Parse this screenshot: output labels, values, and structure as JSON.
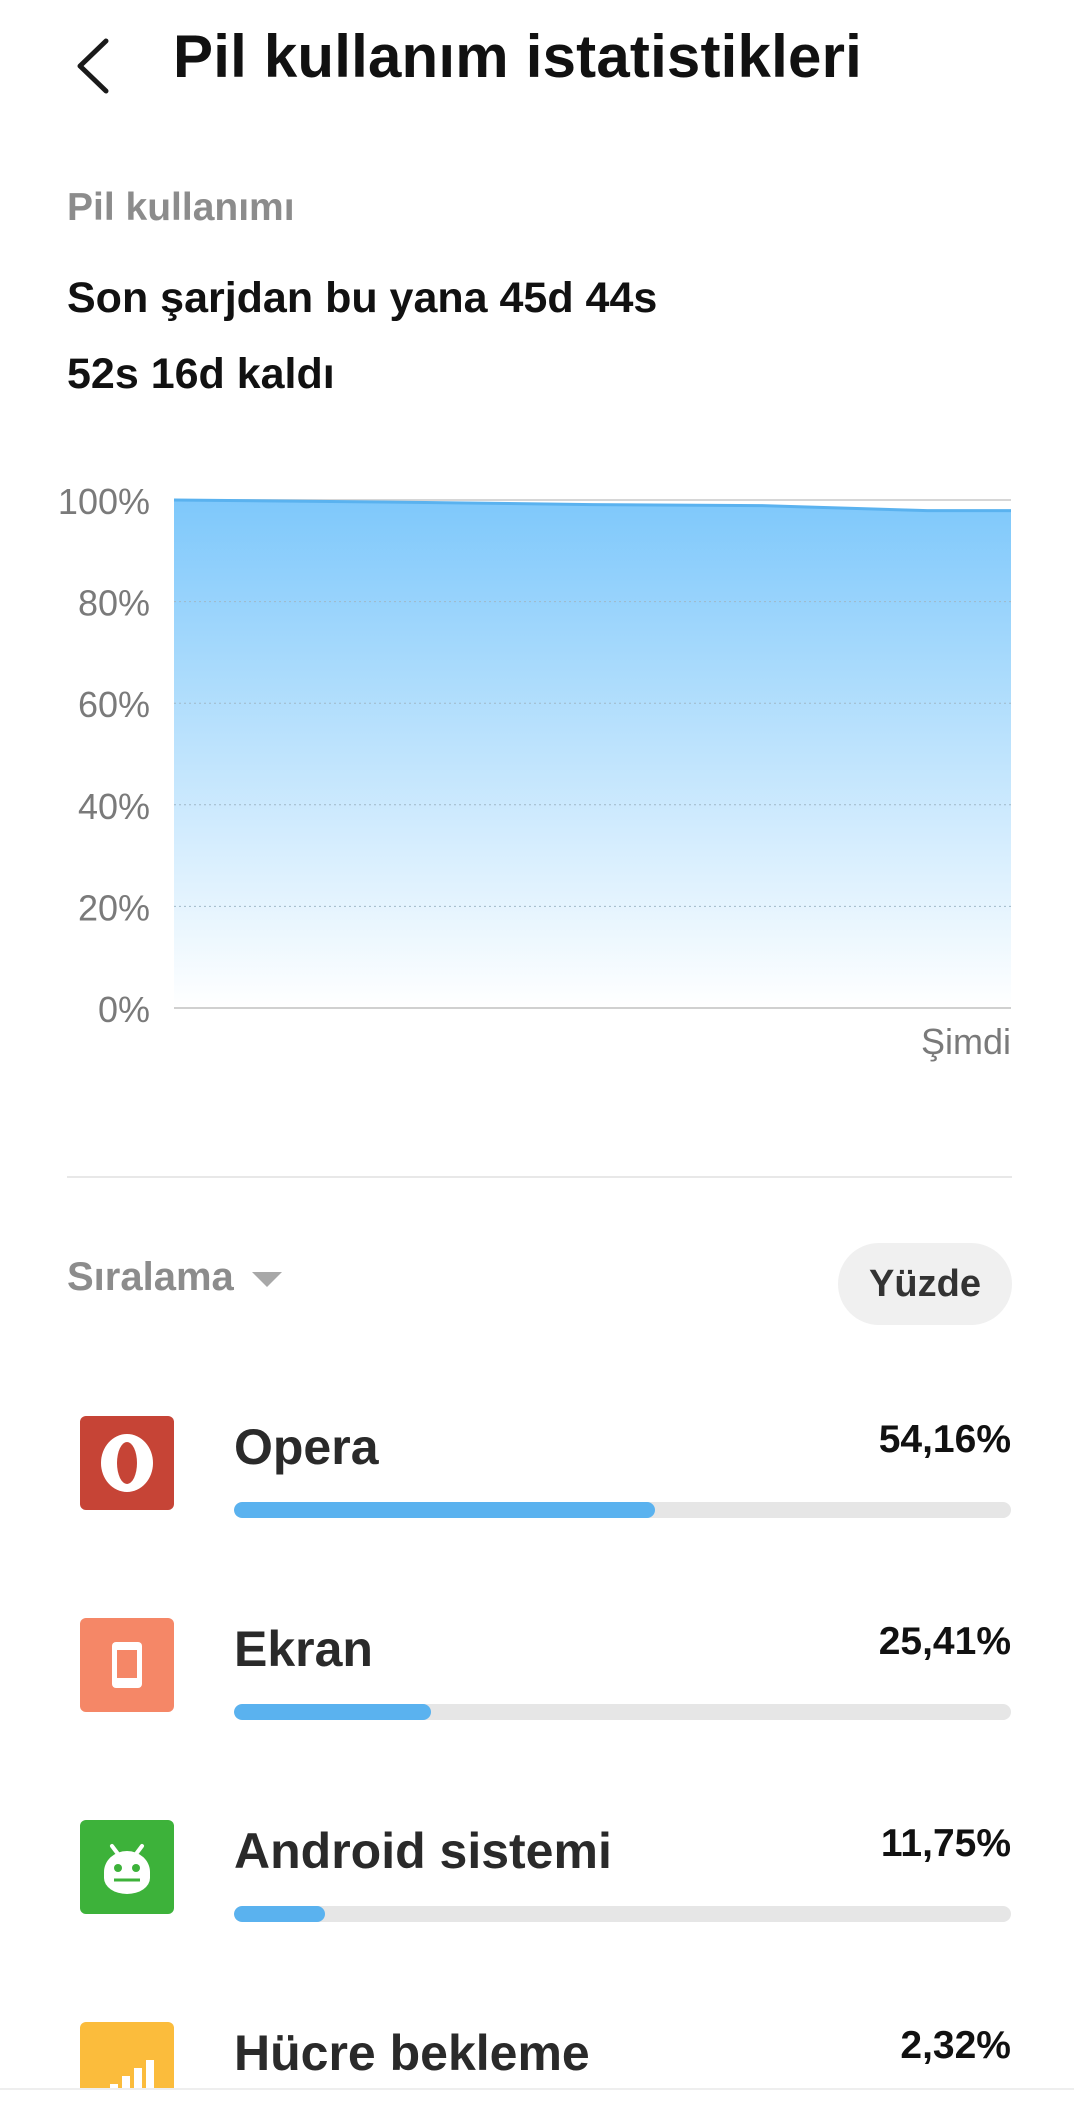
{
  "header": {
    "title": "Pil kullanım istatistikleri",
    "back_icon": "back-arrow-icon"
  },
  "summary": {
    "section_label": "Pil kullanımı",
    "since_charge": "Son şarjdan bu yana 45d 44s",
    "remaining": "52s 16d kaldı"
  },
  "chart_data": {
    "type": "area",
    "title": "",
    "xlabel": "",
    "ylabel": "",
    "y_tick_labels": [
      "100%",
      "80%",
      "60%",
      "40%",
      "20%",
      "0%"
    ],
    "y_ticks": [
      100,
      80,
      60,
      40,
      20,
      0
    ],
    "ylim": [
      0,
      100
    ],
    "x_end_label": "Şimdi",
    "grid": true,
    "series": [
      {
        "x": [
          0,
          0.25,
          0.5,
          0.7,
          0.9,
          1.0
        ],
        "values": [
          100,
          99.6,
          99.1,
          98.9,
          97.9,
          97.9
        ]
      }
    ],
    "colors": {
      "line": "#5ab2ef",
      "fill_top": "#7ec8fb",
      "fill_bottom": "#ffffff"
    }
  },
  "sort": {
    "label": "Sıralama",
    "mode_button": "Yüzde"
  },
  "apps": [
    {
      "name": "Opera",
      "percent_label": "54,16%",
      "percent": 54.16,
      "icon": "opera-icon",
      "icon_color": "#c64436"
    },
    {
      "name": "Ekran",
      "percent_label": "25,41%",
      "percent": 25.41,
      "icon": "screen-icon",
      "icon_color": "#f58767"
    },
    {
      "name": "Android sistemi",
      "percent_label": "11,75%",
      "percent": 11.75,
      "icon": "android-icon",
      "icon_color": "#3db23a"
    },
    {
      "name": "Hücre bekleme",
      "percent_label": "2,32%",
      "percent": 2.32,
      "icon": "cell-signal-icon",
      "icon_color": "#fbbc3c"
    }
  ],
  "colors": {
    "accent": "#5ab2ef",
    "track": "#e6e6e6"
  }
}
